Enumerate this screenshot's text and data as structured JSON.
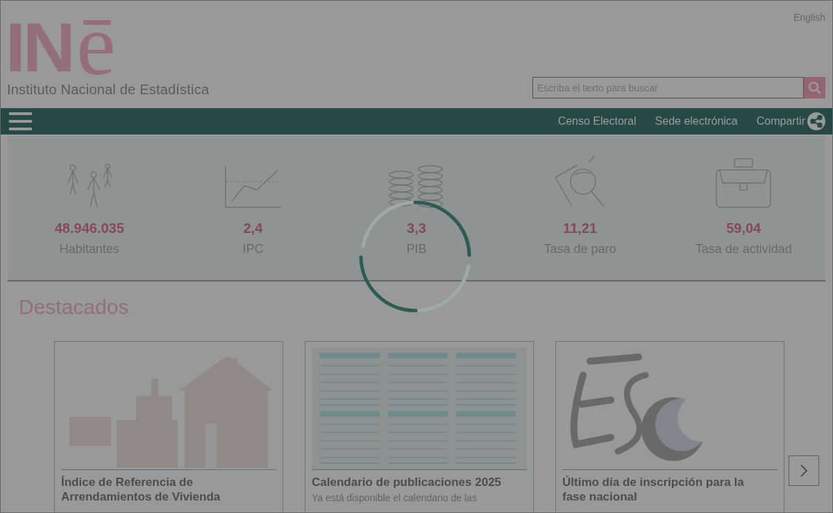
{
  "header": {
    "language_link": "English",
    "logo": {
      "mark": "IN",
      "accent": "ē",
      "name": "Instituto Nacional de Estadística"
    },
    "search": {
      "placeholder": "Escriba el texto para buscar"
    }
  },
  "nav": {
    "links": [
      "Censo Electoral",
      "Sede electrónica"
    ],
    "share": "Compartir"
  },
  "stats": [
    {
      "kind": "people",
      "value": "48.946.035",
      "label": "Habitantes"
    },
    {
      "kind": "chart",
      "value": "2,4",
      "label": "IPC"
    },
    {
      "kind": "coins",
      "value": "3,3",
      "label": "PIB"
    },
    {
      "kind": "magnifier",
      "value": "11,21",
      "label": "Tasa de paro"
    },
    {
      "kind": "briefcase",
      "value": "59,04",
      "label": "Tasa de actividad"
    }
  ],
  "featured": {
    "title": "Destacados",
    "cards": [
      {
        "title": "Índice de Referencia de Arrendamientos de Vivienda"
      },
      {
        "title": "Calendario de publicaciones 2025",
        "description": "Ya está disponible el calendario de las"
      },
      {
        "title": "Último día de inscripción para la fase nacional"
      }
    ]
  },
  "loading": true
}
